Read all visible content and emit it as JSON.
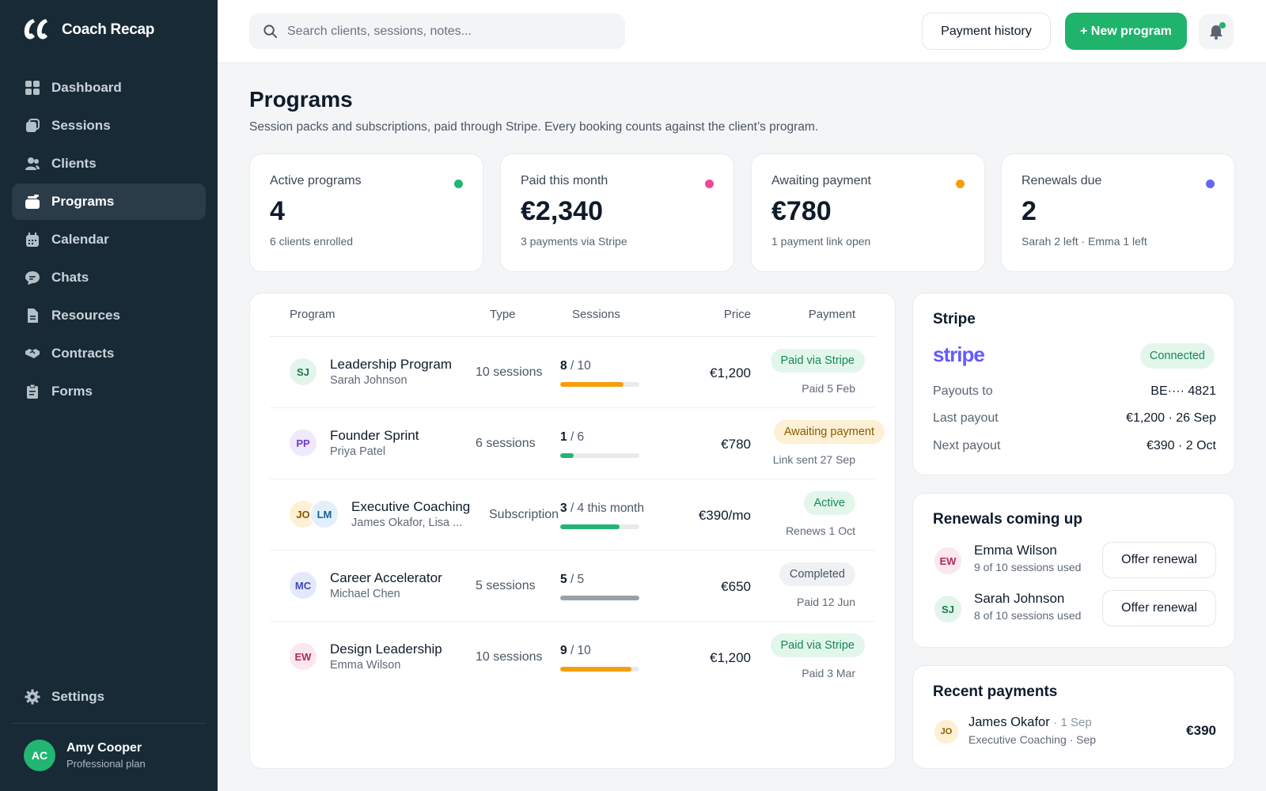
{
  "app": {
    "name": "Coach Recap",
    "logo_icon": "logo-icon"
  },
  "sidebar": {
    "items": [
      {
        "label": "Dashboard",
        "icon": "grid-icon"
      },
      {
        "label": "Sessions",
        "icon": "sessions-icon"
      },
      {
        "label": "Clients",
        "icon": "users-icon"
      },
      {
        "label": "Programs",
        "icon": "programs-icon",
        "active": true
      },
      {
        "label": "Calendar",
        "icon": "calendar-icon"
      },
      {
        "label": "Chats",
        "icon": "chat-icon"
      },
      {
        "label": "Resources",
        "icon": "document-icon"
      },
      {
        "label": "Contracts",
        "icon": "handshake-icon"
      },
      {
        "label": "Forms",
        "icon": "clipboard-icon"
      }
    ],
    "settings_label": "Settings",
    "user": {
      "initials": "AC",
      "name": "Amy Cooper",
      "plan": "Professional plan"
    }
  },
  "topbar": {
    "search_placeholder": "Search clients, sessions, notes...",
    "payment_history_label": "Payment history",
    "new_program_label": "+ New program"
  },
  "page": {
    "title": "Programs",
    "subtitle": "Session packs and subscriptions, paid through Stripe. Every booking counts against the client’s program."
  },
  "stats": [
    {
      "label": "Active programs",
      "value": "4",
      "note": "6 clients enrolled",
      "color": "#22b573"
    },
    {
      "label": "Paid this month",
      "value": "€2,340",
      "note": "3 payments via Stripe",
      "color": "#ec4899"
    },
    {
      "label": "Awaiting payment",
      "value": "€780",
      "note": "1 payment link open",
      "color": "#f59e0b"
    },
    {
      "label": "Renewals due",
      "value": "2",
      "note": "Sarah 2 left · Emma 1 left",
      "color": "#6366f1"
    }
  ],
  "table": {
    "headers": {
      "program": "Program",
      "type": "Type",
      "sessions": "Sessions",
      "price": "Price",
      "payment": "Payment"
    },
    "rows": [
      {
        "avatars": [
          {
            "initials": "SJ",
            "bg": "#e3f4ec",
            "fg": "#1a7a4c"
          }
        ],
        "name": "Leadership Program",
        "client": "Sarah Johnson",
        "type": "10 sessions",
        "used": "8",
        "total": "/ 10",
        "progress": 0.8,
        "bar_color": "#f59e0b",
        "price": "€1,200",
        "badge": "Paid via Stripe",
        "badge_bg": "#e3f6ec",
        "badge_fg": "#138a52",
        "note": "Paid 5 Feb"
      },
      {
        "avatars": [
          {
            "initials": "PP",
            "bg": "#efe9fb",
            "fg": "#6d3fc4"
          }
        ],
        "name": "Founder Sprint",
        "client": "Priya Patel",
        "type": "6 sessions",
        "used": "1",
        "total": "/ 6",
        "progress": 0.167,
        "bar_color": "#22b573",
        "price": "€780",
        "badge": "Awaiting payment",
        "badge_bg": "#fdf0d5",
        "badge_fg": "#8a5a00",
        "note": "Link sent 27 Sep"
      },
      {
        "avatars": [
          {
            "initials": "JO",
            "bg": "#fdf0d5",
            "fg": "#8a5a00"
          },
          {
            "initials": "LM",
            "bg": "#e1f0fb",
            "fg": "#1c5f8e"
          }
        ],
        "name": "Executive Coaching",
        "client": "James Okafor, Lisa ...",
        "type": "Subscription",
        "used": "3",
        "total": "/ 4 this month",
        "progress": 0.75,
        "bar_color": "#22b573",
        "price": "€390/mo",
        "badge": "Active",
        "badge_bg": "#e3f6ec",
        "badge_fg": "#138a52",
        "note": "Renews 1 Oct"
      },
      {
        "avatars": [
          {
            "initials": "MC",
            "bg": "#e4e8fb",
            "fg": "#3b4bb3"
          }
        ],
        "name": "Career Accelerator",
        "client": "Michael Chen",
        "type": "5 sessions",
        "used": "5",
        "total": "/ 5",
        "progress": 1.0,
        "bar_color": "#9aa0a8",
        "price": "€650",
        "badge": "Completed",
        "badge_bg": "#f0f1f3",
        "badge_fg": "#4b5663",
        "note": "Paid 12 Jun"
      },
      {
        "avatars": [
          {
            "initials": "EW",
            "bg": "#fbe7ee",
            "fg": "#b02a5e"
          }
        ],
        "name": "Design Leadership",
        "client": "Emma Wilson",
        "type": "10 sessions",
        "used": "9",
        "total": "/ 10",
        "progress": 0.9,
        "bar_color": "#f59e0b",
        "price": "€1,200",
        "badge": "Paid via Stripe",
        "badge_bg": "#e3f6ec",
        "badge_fg": "#138a52",
        "note": "Paid 3 Mar"
      }
    ]
  },
  "stripe": {
    "title": "Stripe",
    "logo": "stripe",
    "status": "Connected",
    "rows": [
      {
        "k": "Payouts to",
        "v": "BE···· 4821"
      },
      {
        "k": "Last payout",
        "v": "€1,200 · 26 Sep"
      },
      {
        "k": "Next payout",
        "v": "€390 · 2 Oct"
      }
    ]
  },
  "renewals": {
    "title": "Renewals coming up",
    "items": [
      {
        "initials": "EW",
        "bg": "#fbe7ee",
        "fg": "#b02a5e",
        "name": "Emma Wilson",
        "sub": "9 of 10 sessions used",
        "action": "Offer renewal"
      },
      {
        "initials": "SJ",
        "bg": "#e3f4ec",
        "fg": "#1a7a4c",
        "name": "Sarah Johnson",
        "sub": "8 of 10 sessions used",
        "action": "Offer renewal"
      }
    ]
  },
  "recent": {
    "title": "Recent payments",
    "items": [
      {
        "initials": "JO",
        "bg": "#fdf0d5",
        "fg": "#8a5a00",
        "name": "James Okafor",
        "date": "· 1 Sep",
        "sub": "Executive Coaching · Sep",
        "amount": "€390"
      }
    ]
  }
}
